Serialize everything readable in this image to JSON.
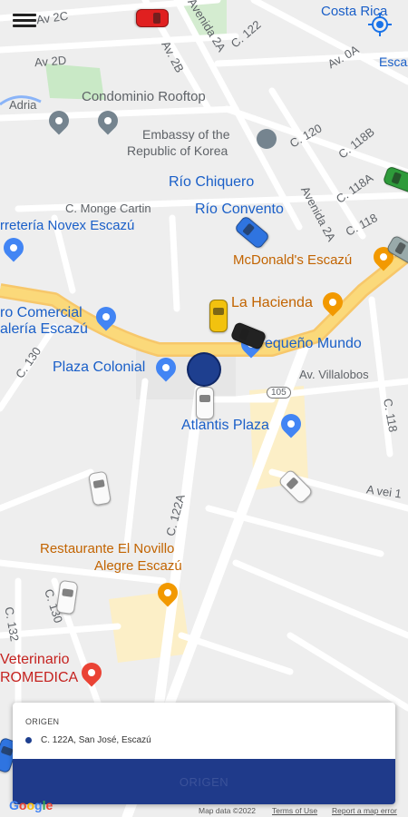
{
  "app": {
    "menu_icon": "hamburger-menu-icon",
    "locate_icon": "my-location-icon"
  },
  "map": {
    "streets": {
      "av_2c": "Av 2C",
      "av_2d": "Av 2D",
      "av_2b": "Av. 2B",
      "avenida_2a_top": "Avenida 2A",
      "c_122_top": "C. 122",
      "av_0a": "Av. 0A",
      "c_120": "C. 120",
      "c_118b": "C. 118B",
      "c_118a": "C. 118A",
      "avenida_2a_mid": "Avenida 2A",
      "c_118_right": "C. 118",
      "c_monge_cartin": "C. Monge Cartin",
      "c_130": "C. 130",
      "av_villalobos": "Av. Villalobos",
      "c_118_lower": "C. 118",
      "route_105": "105",
      "c_122a": "C. 122A",
      "a_vei": "A vei 1",
      "c_132": "C. 132",
      "c_130_low": "C. 130"
    },
    "places": {
      "costa_rica": "Costa Rica",
      "escazu_edge": "Escaz",
      "adria": "Adria",
      "condominio": "Condominio Rooftop",
      "embassy_line1": "Embassy of the",
      "embassy_line2": "Republic of Korea",
      "rio_chiquero": "Río Chiquero",
      "rio_convento": "Río Convento",
      "ferreteria": "rretería Novex Escazú",
      "mcdonalds": "McDonald's Escazú",
      "la_hacienda": "La Hacienda",
      "centro_line1": "ro Comercial",
      "centro_line2": "alería Escazú",
      "pequeno_mundo": "equeño Mundo",
      "plaza_colonial": "Plaza Colonial",
      "atlantis": "Atlantis Plaza",
      "novillo_line1": "Restaurante El Novillo",
      "novillo_line2": "Alegre Escazú",
      "veterinario_line1": "Veterinario",
      "veterinario_line2": "ROMEDICA"
    },
    "attribution": {
      "google": "Google",
      "map_data": "Map data ©2022",
      "terms": "Terms of Use",
      "report": "Report a map error"
    }
  },
  "panel": {
    "title": "ORIGEN",
    "origin_address": "C. 122A, San José, Escazú",
    "button_label": "ORIGEN"
  },
  "colors": {
    "primary": "#1f3a8a",
    "user_dot": "#1e3f8f",
    "main_road": "#fbd97a",
    "park": "#c9e9c6"
  }
}
